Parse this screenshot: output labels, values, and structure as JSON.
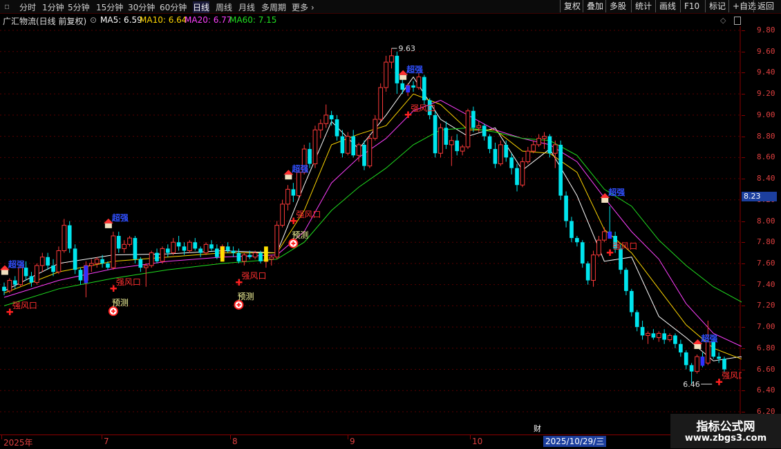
{
  "toolbar": {
    "left": [
      "分时",
      "1分钟",
      "5分钟",
      "15分钟",
      "30分钟",
      "60分钟",
      "日线",
      "周线",
      "月线",
      "多周期",
      "更多"
    ],
    "active": "日线",
    "right": [
      "复权",
      "叠加",
      "多股",
      "统计",
      "画线",
      "F10",
      "标记",
      "+自选",
      "返回"
    ]
  },
  "info": {
    "stock": "广汇物流(日线 前复权)",
    "ma5": "MA5: 6.59",
    "ma10": "MA10: 6.64",
    "ma20": "MA20: 6.77",
    "ma60": "MA60: 7.15"
  },
  "axis": {
    "labels": [
      "9.80",
      "9.60",
      "9.40",
      "9.20",
      "9.00",
      "8.80",
      "8.60",
      "8.40",
      "8.20",
      "8.00",
      "7.80",
      "7.60",
      "7.40",
      "7.20",
      "7.00",
      "6.80",
      "6.60",
      "6.40",
      "6.20"
    ],
    "current": "8.23"
  },
  "dates": {
    "months": [
      "2025年",
      "7",
      "8",
      "9",
      "10"
    ],
    "selected": "2025/10/29/三"
  },
  "markers": {
    "high": "9.63",
    "low": "6.46",
    "cai": "财"
  },
  "watermark": {
    "line1": "指标公式网",
    "line2": "www.zbgs3.com"
  },
  "colors": {
    "up": "#ff3a3a",
    "down": "#00e5ee",
    "ma5": "#ffffff",
    "ma10": "#ffd700",
    "ma20": "#ff40ff",
    "ma60": "#20e020",
    "grid": "#5a0000"
  },
  "chart_data": {
    "type": "candlestick",
    "ylim": [
      6.2,
      9.85
    ],
    "candles": [
      [
        7.38,
        7.42,
        7.3,
        7.34
      ],
      [
        7.34,
        7.46,
        7.32,
        7.44
      ],
      [
        7.44,
        7.48,
        7.36,
        7.4
      ],
      [
        7.4,
        7.6,
        7.38,
        7.56
      ],
      [
        7.56,
        7.62,
        7.44,
        7.48
      ],
      [
        7.48,
        7.52,
        7.38,
        7.42
      ],
      [
        7.42,
        7.6,
        7.4,
        7.58
      ],
      [
        7.58,
        7.7,
        7.52,
        7.66
      ],
      [
        7.66,
        7.7,
        7.54,
        7.58
      ],
      [
        7.58,
        7.64,
        7.48,
        7.52
      ],
      [
        7.52,
        7.76,
        7.5,
        7.72
      ],
      [
        7.72,
        8.02,
        7.7,
        7.96
      ],
      [
        7.96,
        8.0,
        7.7,
        7.74
      ],
      [
        7.74,
        7.78,
        7.5,
        7.54
      ],
      [
        7.54,
        7.56,
        7.4,
        7.44
      ],
      [
        7.44,
        7.62,
        7.28,
        7.58
      ],
      [
        7.58,
        7.64,
        7.52,
        7.6
      ],
      [
        7.6,
        7.66,
        7.56,
        7.64
      ],
      [
        7.64,
        7.68,
        7.56,
        7.6
      ],
      [
        7.6,
        7.62,
        7.54,
        7.56
      ],
      [
        7.56,
        7.9,
        7.54,
        7.86
      ],
      [
        7.86,
        7.9,
        7.7,
        7.74
      ],
      [
        7.74,
        7.82,
        7.7,
        7.78
      ],
      [
        7.78,
        7.86,
        7.76,
        7.84
      ],
      [
        7.84,
        7.86,
        7.6,
        7.64
      ],
      [
        7.64,
        7.66,
        7.52,
        7.56
      ],
      [
        7.56,
        7.6,
        7.38,
        7.58
      ],
      [
        7.58,
        7.72,
        7.56,
        7.7
      ],
      [
        7.7,
        7.74,
        7.6,
        7.62
      ],
      [
        7.62,
        7.76,
        7.6,
        7.74
      ],
      [
        7.74,
        7.78,
        7.66,
        7.7
      ],
      [
        7.7,
        7.84,
        7.68,
        7.8
      ],
      [
        7.8,
        7.86,
        7.72,
        7.76
      ],
      [
        7.76,
        7.8,
        7.68,
        7.72
      ],
      [
        7.72,
        7.82,
        7.7,
        7.8
      ],
      [
        7.8,
        7.84,
        7.72,
        7.74
      ],
      [
        7.74,
        7.76,
        7.66,
        7.7
      ],
      [
        7.7,
        7.8,
        7.68,
        7.78
      ],
      [
        7.78,
        7.82,
        7.72,
        7.74
      ],
      [
        7.74,
        7.78,
        7.64,
        7.66
      ],
      [
        7.66,
        7.78,
        7.64,
        7.76
      ],
      [
        7.76,
        7.8,
        7.7,
        7.72
      ],
      [
        7.72,
        7.76,
        7.66,
        7.7
      ],
      [
        7.7,
        7.74,
        7.6,
        7.62
      ],
      [
        7.62,
        7.7,
        7.58,
        7.68
      ],
      [
        7.68,
        7.72,
        7.64,
        7.66
      ],
      [
        7.66,
        7.72,
        7.64,
        7.7
      ],
      [
        7.7,
        7.72,
        7.6,
        7.62
      ],
      [
        7.62,
        7.66,
        7.56,
        7.64
      ],
      [
        7.64,
        7.68,
        7.58,
        7.66
      ],
      [
        7.66,
        8.0,
        7.64,
        7.96
      ],
      [
        7.96,
        8.2,
        7.94,
        8.16
      ],
      [
        8.16,
        8.34,
        8.1,
        8.3
      ],
      [
        8.3,
        8.36,
        8.18,
        8.24
      ],
      [
        8.24,
        8.5,
        8.22,
        8.46
      ],
      [
        8.46,
        8.72,
        8.44,
        8.68
      ],
      [
        8.68,
        8.74,
        8.5,
        8.54
      ],
      [
        8.54,
        8.9,
        8.5,
        8.86
      ],
      [
        8.86,
        8.96,
        8.78,
        8.92
      ],
      [
        8.92,
        9.1,
        8.88,
        9.0
      ],
      [
        9.0,
        9.04,
        8.9,
        8.96
      ],
      [
        8.96,
        9.0,
        8.76,
        8.8
      ],
      [
        8.8,
        8.86,
        8.6,
        8.64
      ],
      [
        8.64,
        8.84,
        8.62,
        8.8
      ],
      [
        8.8,
        8.86,
        8.6,
        8.62
      ],
      [
        8.62,
        8.74,
        8.56,
        8.72
      ],
      [
        8.72,
        8.76,
        8.48,
        8.52
      ],
      [
        8.52,
        8.82,
        8.5,
        8.78
      ],
      [
        8.78,
        9.0,
        8.76,
        8.96
      ],
      [
        8.96,
        9.3,
        8.94,
        9.26
      ],
      [
        9.26,
        9.56,
        9.22,
        9.5
      ],
      [
        9.5,
        9.63,
        9.44,
        9.56
      ],
      [
        9.56,
        9.6,
        9.2,
        9.3
      ],
      [
        9.3,
        9.34,
        9.2,
        9.24
      ],
      [
        9.24,
        9.3,
        9.18,
        9.28
      ],
      [
        9.28,
        9.32,
        9.22,
        9.26
      ],
      [
        9.26,
        9.4,
        9.24,
        9.36
      ],
      [
        9.36,
        9.38,
        9.1,
        9.14
      ],
      [
        9.14,
        9.16,
        8.96,
        9.0
      ],
      [
        9.0,
        9.04,
        8.6,
        8.64
      ],
      [
        8.64,
        8.92,
        8.6,
        8.88
      ],
      [
        8.88,
        8.94,
        8.68,
        8.72
      ],
      [
        8.72,
        8.8,
        8.52,
        8.76
      ],
      [
        8.76,
        8.82,
        8.62,
        8.66
      ],
      [
        8.66,
        8.72,
        8.62,
        8.7
      ],
      [
        8.7,
        9.06,
        8.68,
        9.04
      ],
      [
        9.04,
        9.08,
        8.84,
        8.88
      ],
      [
        8.88,
        8.94,
        8.84,
        8.9
      ],
      [
        8.9,
        8.92,
        8.76,
        8.8
      ],
      [
        8.8,
        8.82,
        8.64,
        8.68
      ],
      [
        8.68,
        8.74,
        8.5,
        8.54
      ],
      [
        8.54,
        8.76,
        8.52,
        8.72
      ],
      [
        8.72,
        8.76,
        8.56,
        8.6
      ],
      [
        8.6,
        8.64,
        8.44,
        8.5
      ],
      [
        8.5,
        8.54,
        8.28,
        8.34
      ],
      [
        8.34,
        8.6,
        8.32,
        8.56
      ],
      [
        8.56,
        8.7,
        8.54,
        8.66
      ],
      [
        8.66,
        8.76,
        8.64,
        8.72
      ],
      [
        8.72,
        8.82,
        8.7,
        8.78
      ],
      [
        8.78,
        8.84,
        8.68,
        8.8
      ],
      [
        8.8,
        8.82,
        8.6,
        8.64
      ],
      [
        8.64,
        8.76,
        8.5,
        8.72
      ],
      [
        8.72,
        8.76,
        8.2,
        8.24
      ],
      [
        8.24,
        8.28,
        7.94,
        8.0
      ],
      [
        8.0,
        8.04,
        7.8,
        7.84
      ],
      [
        7.84,
        7.86,
        7.76,
        7.8
      ],
      [
        7.8,
        7.82,
        7.56,
        7.6
      ],
      [
        7.6,
        7.62,
        7.4,
        7.44
      ],
      [
        7.44,
        7.72,
        7.38,
        7.68
      ],
      [
        7.68,
        7.86,
        7.66,
        7.82
      ],
      [
        7.82,
        7.94,
        7.8,
        7.9
      ],
      [
        7.9,
        8.14,
        7.88,
        7.86
      ],
      [
        7.86,
        7.9,
        7.7,
        7.74
      ],
      [
        7.74,
        7.78,
        7.5,
        7.54
      ],
      [
        7.54,
        7.56,
        7.3,
        7.34
      ],
      [
        7.34,
        7.36,
        7.1,
        7.14
      ],
      [
        7.14,
        7.16,
        6.96,
        7.0
      ],
      [
        7.0,
        7.06,
        6.88,
        6.92
      ],
      [
        6.92,
        6.96,
        6.84,
        6.94
      ],
      [
        6.94,
        6.98,
        6.88,
        6.9
      ],
      [
        6.9,
        6.96,
        6.86,
        6.94
      ],
      [
        6.94,
        6.98,
        6.84,
        6.88
      ],
      [
        6.88,
        6.94,
        6.86,
        6.92
      ],
      [
        6.92,
        6.94,
        6.8,
        6.84
      ],
      [
        6.84,
        6.88,
        6.72,
        6.76
      ],
      [
        6.76,
        6.78,
        6.6,
        6.64
      ],
      [
        6.64,
        6.66,
        6.46,
        6.58
      ],
      [
        6.58,
        6.74,
        6.56,
        6.72
      ],
      [
        6.72,
        6.76,
        6.62,
        6.66
      ],
      [
        6.66,
        7.06,
        6.64,
        6.86
      ],
      [
        6.86,
        6.9,
        6.7,
        6.72
      ],
      [
        6.72,
        6.76,
        6.66,
        6.7
      ],
      [
        6.7,
        6.72,
        6.56,
        6.6
      ]
    ],
    "ma_lines": [
      {
        "name": "MA5",
        "values": [
          [
            0,
            7.34
          ],
          [
            10,
            7.6
          ],
          [
            20,
            7.68
          ],
          [
            30,
            7.69
          ],
          [
            40,
            7.72
          ],
          [
            50,
            7.7
          ],
          [
            55,
            8.34
          ],
          [
            60,
            8.94
          ],
          [
            65,
            8.68
          ],
          [
            70,
            9.0
          ],
          [
            75,
            9.36
          ],
          [
            80,
            8.96
          ],
          [
            85,
            8.8
          ],
          [
            90,
            8.88
          ],
          [
            95,
            8.48
          ],
          [
            100,
            8.68
          ],
          [
            105,
            8.24
          ],
          [
            110,
            7.62
          ],
          [
            115,
            7.66
          ],
          [
            120,
            7.1
          ],
          [
            125,
            6.9
          ],
          [
            130,
            6.68
          ],
          [
            135,
            6.72
          ],
          [
            138,
            6.64
          ]
        ]
      },
      {
        "name": "MA10",
        "values": [
          [
            0,
            7.32
          ],
          [
            10,
            7.52
          ],
          [
            20,
            7.62
          ],
          [
            30,
            7.66
          ],
          [
            40,
            7.7
          ],
          [
            50,
            7.7
          ],
          [
            55,
            8.1
          ],
          [
            60,
            8.72
          ],
          [
            65,
            8.82
          ],
          [
            70,
            8.9
          ],
          [
            75,
            9.2
          ],
          [
            80,
            9.1
          ],
          [
            85,
            8.86
          ],
          [
            90,
            8.86
          ],
          [
            95,
            8.66
          ],
          [
            100,
            8.64
          ],
          [
            105,
            8.46
          ],
          [
            110,
            7.92
          ],
          [
            115,
            7.7
          ],
          [
            120,
            7.36
          ],
          [
            125,
            7.02
          ],
          [
            130,
            6.8
          ],
          [
            135,
            6.7
          ],
          [
            138,
            6.66
          ]
        ]
      },
      {
        "name": "MA20",
        "values": [
          [
            0,
            7.28
          ],
          [
            10,
            7.44
          ],
          [
            20,
            7.55
          ],
          [
            30,
            7.62
          ],
          [
            40,
            7.66
          ],
          [
            50,
            7.68
          ],
          [
            55,
            7.9
          ],
          [
            60,
            8.36
          ],
          [
            65,
            8.6
          ],
          [
            70,
            8.78
          ],
          [
            75,
            9.04
          ],
          [
            80,
            9.14
          ],
          [
            85,
            9.0
          ],
          [
            90,
            8.86
          ],
          [
            95,
            8.78
          ],
          [
            100,
            8.72
          ],
          [
            105,
            8.56
          ],
          [
            110,
            8.22
          ],
          [
            115,
            7.9
          ],
          [
            120,
            7.64
          ],
          [
            125,
            7.22
          ],
          [
            130,
            6.94
          ],
          [
            135,
            6.82
          ],
          [
            138,
            6.77
          ]
        ]
      },
      {
        "name": "MA60",
        "values": [
          [
            0,
            7.2
          ],
          [
            10,
            7.36
          ],
          [
            20,
            7.46
          ],
          [
            30,
            7.54
          ],
          [
            40,
            7.6
          ],
          [
            50,
            7.64
          ],
          [
            55,
            7.8
          ],
          [
            60,
            8.1
          ],
          [
            65,
            8.32
          ],
          [
            70,
            8.5
          ],
          [
            75,
            8.72
          ],
          [
            80,
            8.86
          ],
          [
            85,
            8.88
          ],
          [
            90,
            8.84
          ],
          [
            95,
            8.78
          ],
          [
            100,
            8.76
          ],
          [
            105,
            8.62
          ],
          [
            110,
            8.3
          ],
          [
            115,
            8.14
          ],
          [
            120,
            7.82
          ],
          [
            125,
            7.58
          ],
          [
            130,
            7.38
          ],
          [
            135,
            7.24
          ],
          [
            138,
            7.15
          ]
        ]
      }
    ],
    "annotations": {
      "qiangfengkou": [
        "强风口",
        "强风口",
        "强风口",
        "强风口",
        "强风口",
        "强风口",
        "强风口"
      ],
      "qiangfengkou_idx": [
        1,
        20,
        43,
        53,
        74,
        111,
        131
      ],
      "yuce": [
        "预测",
        "预测",
        "预测"
      ],
      "yuce_idx": [
        20,
        43,
        53
      ],
      "chaoqiang": [
        "超强",
        "超强",
        "超强",
        "超强",
        "超强",
        "超强"
      ],
      "chaoqiang_idx": [
        1,
        20,
        53,
        74,
        111,
        128
      ]
    }
  }
}
